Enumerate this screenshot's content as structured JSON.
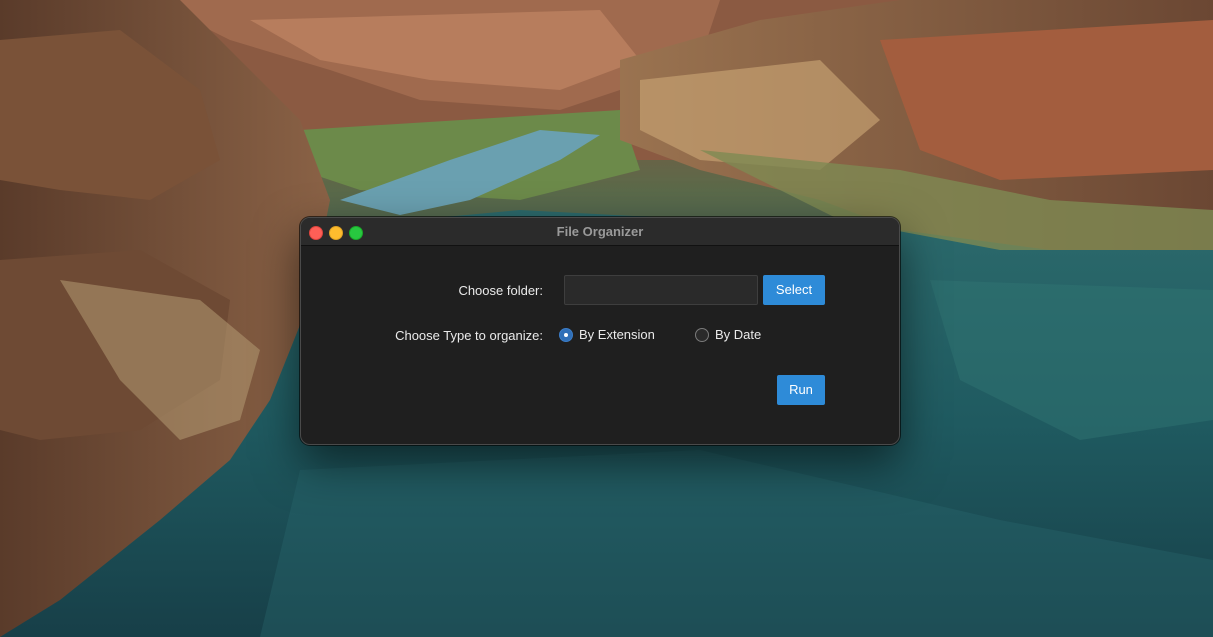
{
  "desktop": {
    "wallpaper": "canyon-river-landscape"
  },
  "window": {
    "title": "File Organizer",
    "controls": {
      "close_color": "#fe5f57",
      "minimize_color": "#febc2e",
      "maximize_color": "#28c840"
    }
  },
  "form": {
    "folder_label": "Choose folder:",
    "folder_value": "",
    "select_label": "Select",
    "type_label": "Choose Type to organize:",
    "options": [
      {
        "label": "By Extension",
        "checked": true
      },
      {
        "label": "By Date",
        "checked": false
      }
    ],
    "run_label": "Run",
    "accent_color": "#2e8bd8"
  }
}
